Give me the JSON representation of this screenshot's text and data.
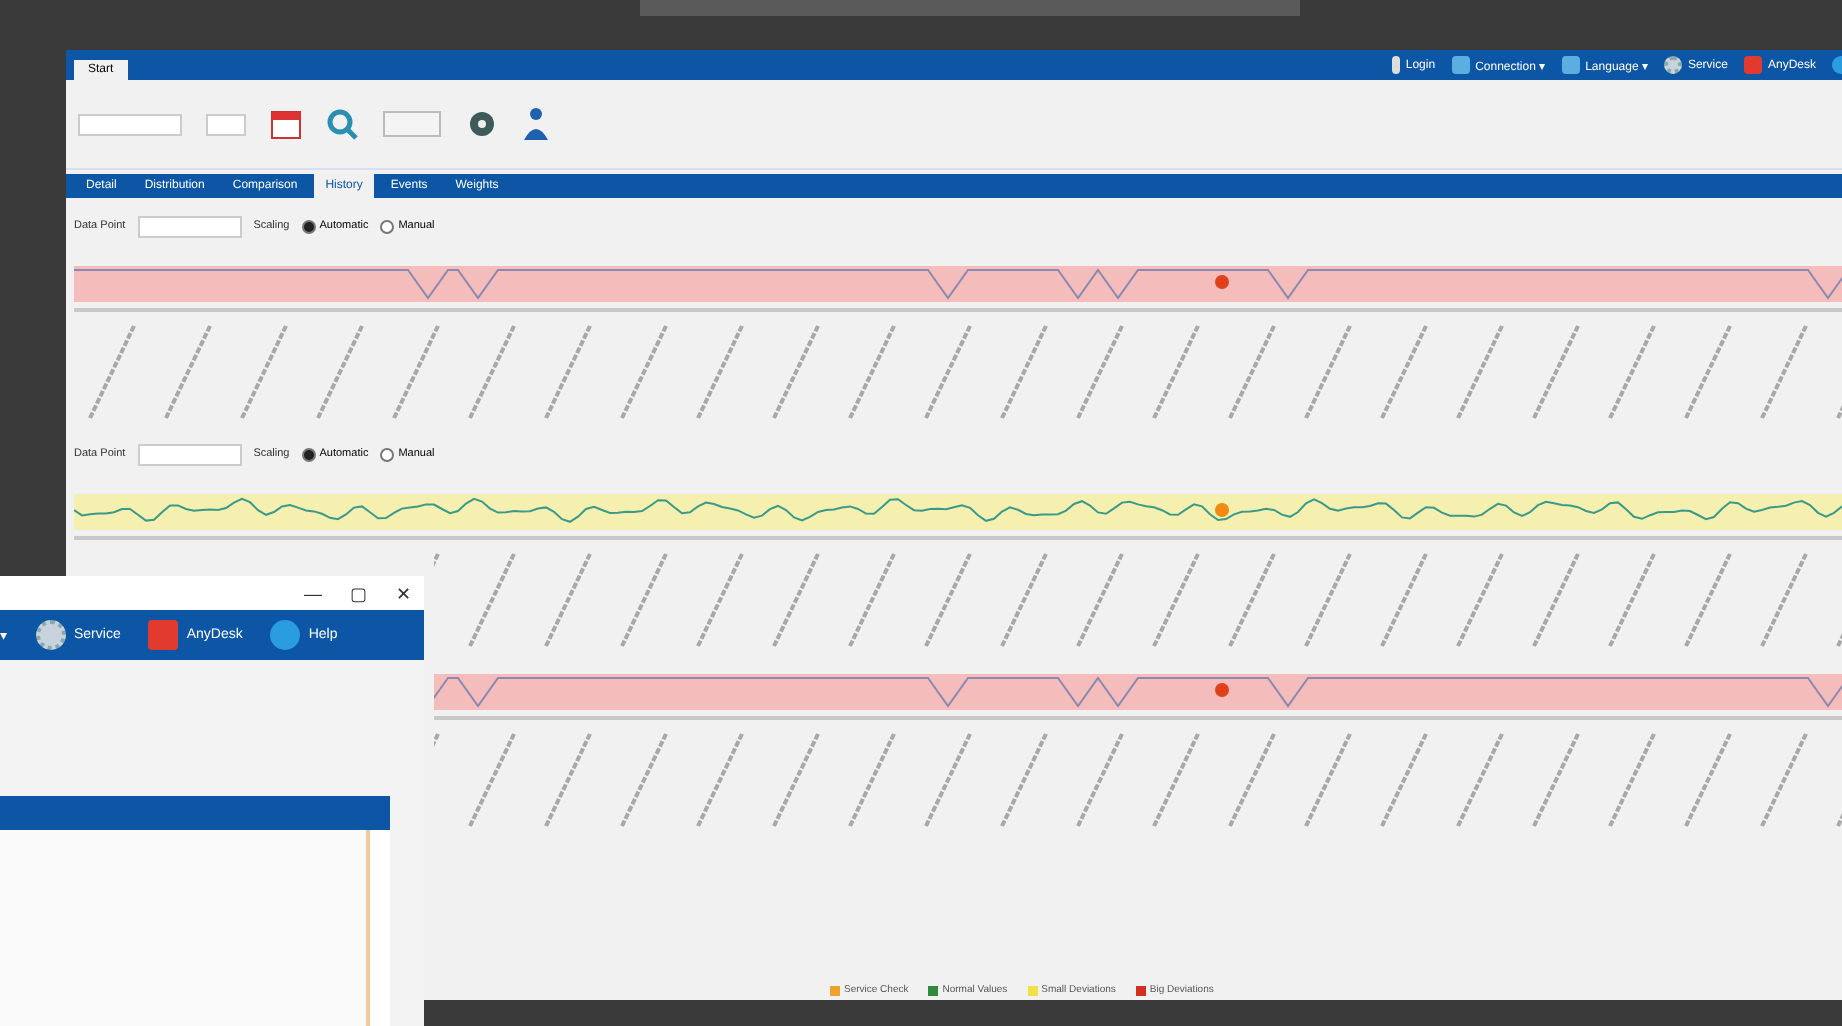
{
  "back_window": {
    "app_tab": "Start",
    "top_menu": [
      {
        "kind": "user",
        "label": "Login"
      },
      {
        "kind": "screen",
        "label": "Connection ▾"
      },
      {
        "kind": "flag",
        "label": "Language ▾"
      },
      {
        "kind": "gear",
        "label": "Service"
      },
      {
        "kind": "remote",
        "label": "AnyDesk"
      },
      {
        "kind": "help"
      }
    ],
    "tabs": [
      {
        "label": "Detail",
        "selected": false
      },
      {
        "label": "Distribution",
        "selected": false
      },
      {
        "label": "Comparison",
        "selected": false
      },
      {
        "label": "History",
        "selected": true
      },
      {
        "label": "Events",
        "selected": false
      },
      {
        "label": "Weights",
        "selected": false
      }
    ],
    "panels": [
      {
        "kind": "red",
        "data_point": "Data Point",
        "scaling": "Scaling",
        "options": [
          {
            "label": "Automatic",
            "selected": true
          },
          {
            "label": "Manual",
            "selected": false
          }
        ]
      },
      {
        "kind": "yellow",
        "data_point": "Data Point",
        "scaling": "Scaling",
        "options": [
          {
            "label": "Automatic",
            "selected": true
          },
          {
            "label": "Manual",
            "selected": false
          }
        ]
      },
      {
        "kind": "red"
      }
    ],
    "legend": [
      {
        "label": "Service Check",
        "color": "#f0a030"
      },
      {
        "label": "Normal Values",
        "color": "#2e8b3e"
      },
      {
        "label": "Small Deviations",
        "color": "#f2e04a"
      },
      {
        "label": "Big Deviations",
        "color": "#d03020"
      }
    ]
  },
  "front_window": {
    "title_controls": [
      "—",
      "▢",
      "✕"
    ],
    "toolbar": [
      {
        "kind": "cut",
        "label": "▾"
      },
      {
        "kind": "gear",
        "label": "Service"
      },
      {
        "kind": "remote",
        "label": "AnyDesk"
      },
      {
        "kind": "help",
        "label": "Help"
      }
    ]
  }
}
